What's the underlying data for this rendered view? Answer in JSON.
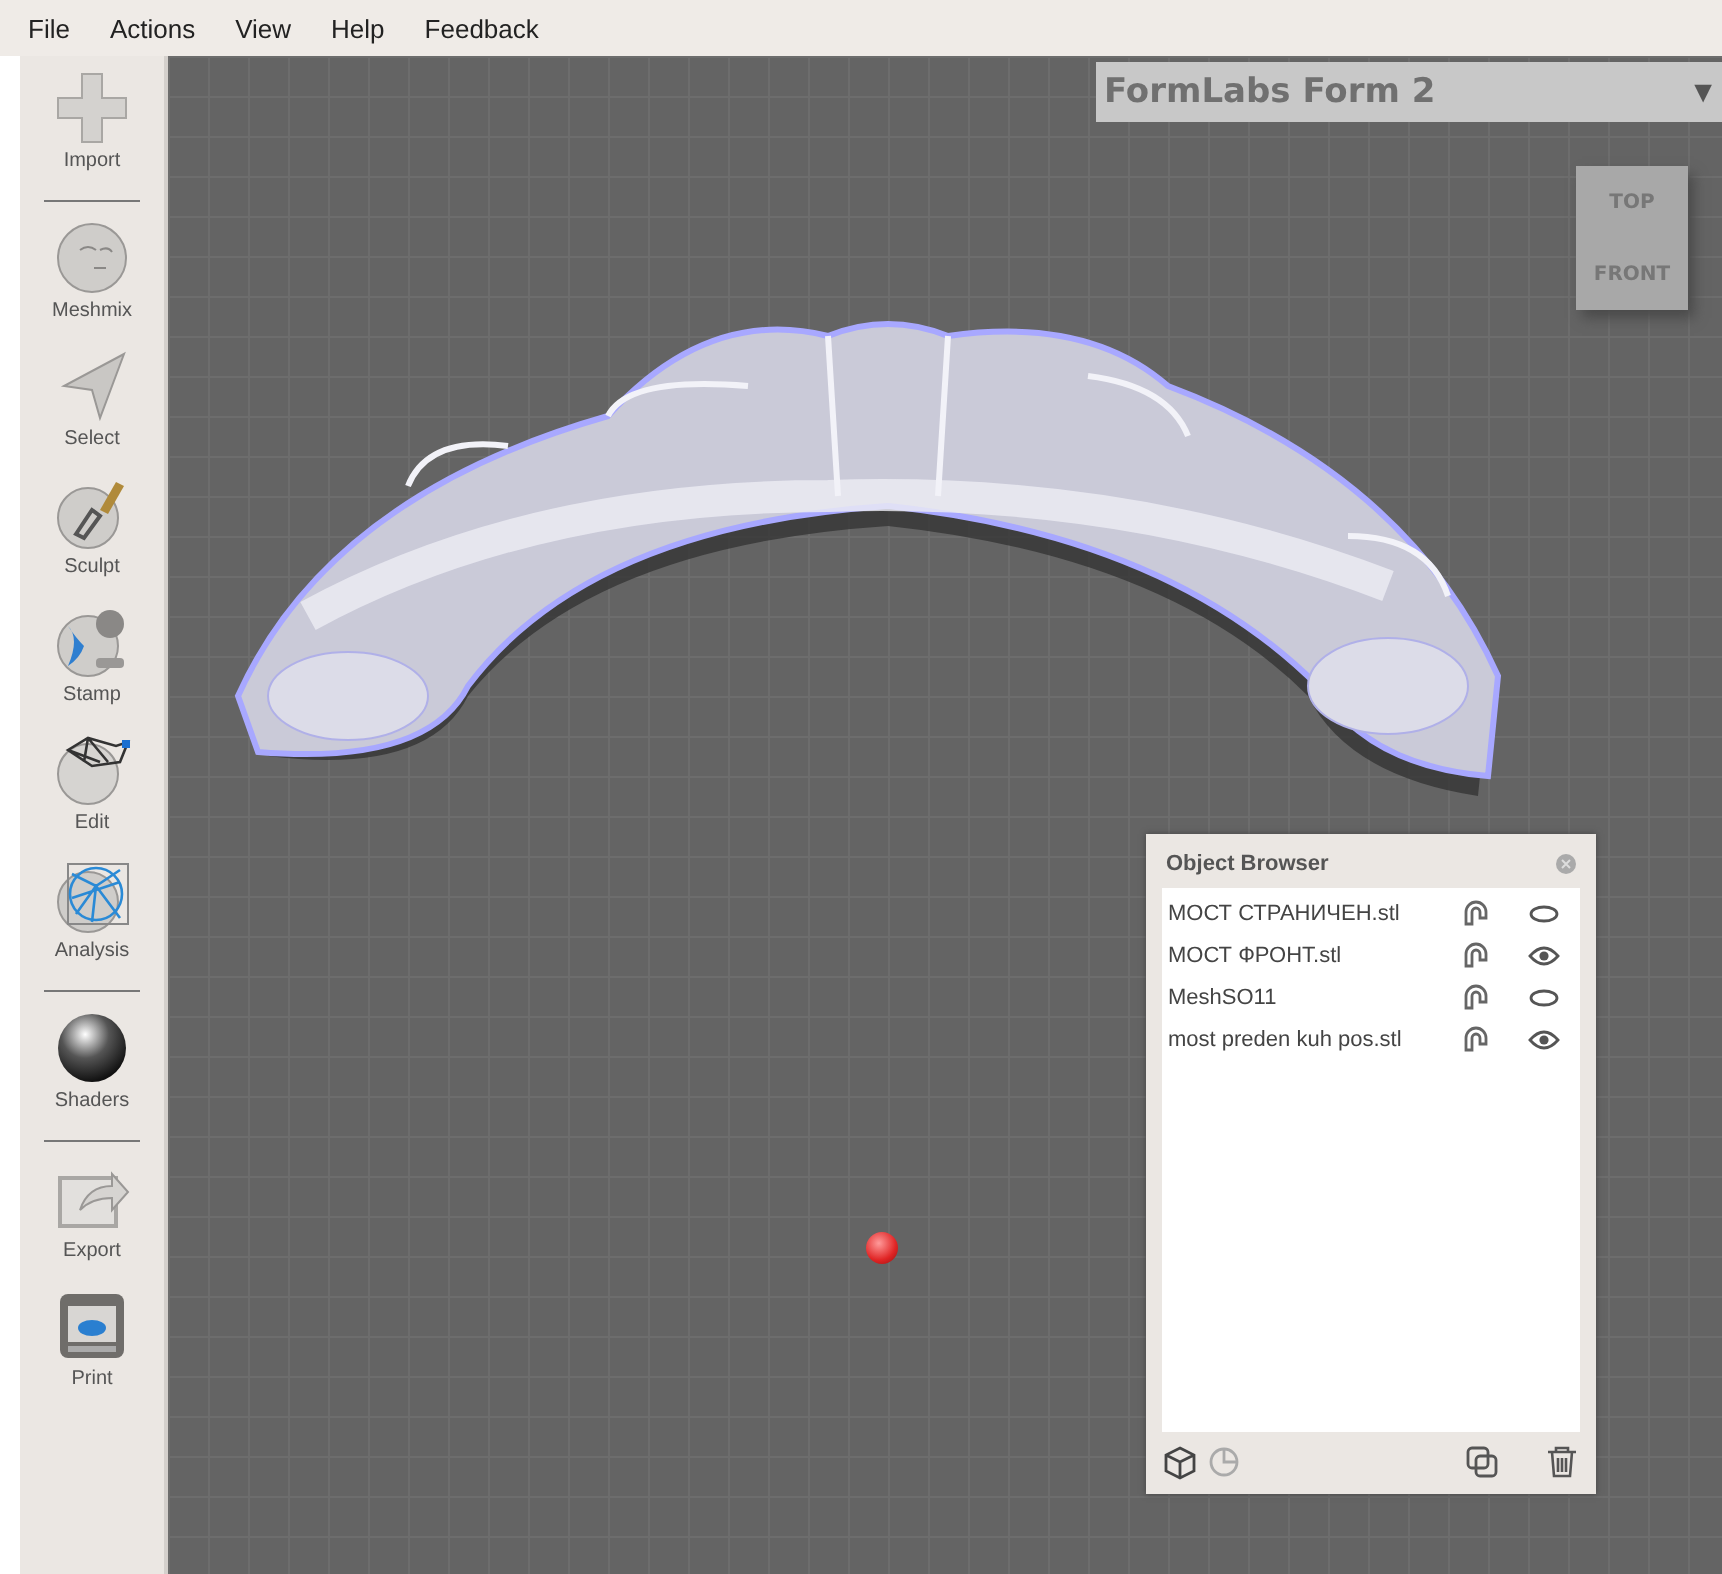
{
  "menu": [
    "File",
    "Actions",
    "View",
    "Help",
    "Feedback"
  ],
  "tools": [
    {
      "kind": "tool",
      "label": "Import"
    },
    {
      "kind": "separator"
    },
    {
      "kind": "tool",
      "label": "Meshmix"
    },
    {
      "kind": "tool",
      "label": "Select"
    },
    {
      "kind": "tool",
      "label": "Sculpt"
    },
    {
      "kind": "tool",
      "label": "Stamp"
    },
    {
      "kind": "tool",
      "label": "Edit"
    },
    {
      "kind": "tool",
      "label": "Analysis"
    },
    {
      "kind": "separator"
    },
    {
      "kind": "tool",
      "label": "Shaders"
    },
    {
      "kind": "separator"
    },
    {
      "kind": "tool",
      "label": "Export"
    },
    {
      "kind": "tool",
      "label": "Print"
    }
  ],
  "printer": {
    "name": "FormLabs Form 2",
    "arrow": "▼"
  },
  "view_cube": {
    "top": "TOP",
    "front": "FRONT"
  },
  "object_browser": {
    "title": "Object Browser",
    "objects": [
      {
        "name": "МОСТ СТРАНИЧЕН.stl",
        "visible": false
      },
      {
        "name": "МОСТ ФРОНТ.stl",
        "visible": true
      },
      {
        "name": "MeshSO11",
        "visible": false
      },
      {
        "name": "most preden kuh pos.stl",
        "visible": true
      }
    ]
  }
}
